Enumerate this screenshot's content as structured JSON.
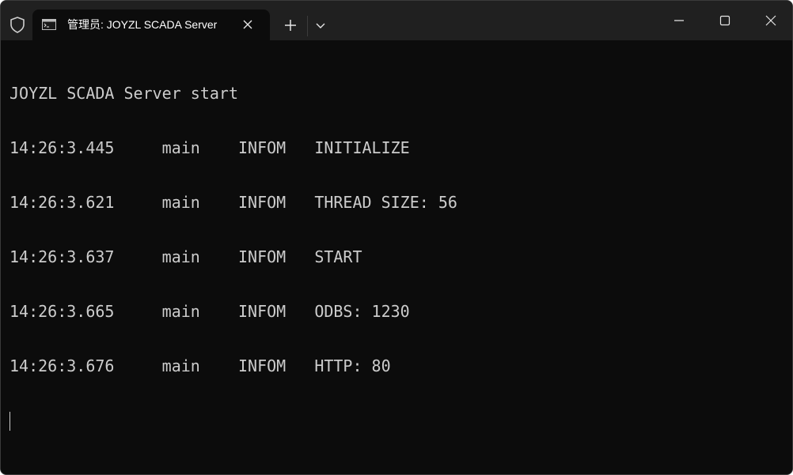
{
  "tab": {
    "title": "管理员:  JOYZL SCADA Server"
  },
  "console": {
    "lines": [
      "JOYZL SCADA Server start",
      "14:26:3.445     main    INFOM   INITIALIZE",
      "14:26:3.621     main    INFOM   THREAD SIZE: 56",
      "14:26:3.637     main    INFOM   START",
      "14:26:3.665     main    INFOM   ODBS: 1230",
      "14:26:3.676     main    INFOM   HTTP: 80"
    ]
  },
  "icons": {
    "shield": "shield-icon",
    "terminal": "terminal-icon",
    "close_tab": "close-icon",
    "new_tab": "plus-icon",
    "dropdown": "chevron-down-icon",
    "minimize": "minimize-icon",
    "maximize": "maximize-icon",
    "close_window": "close-icon"
  },
  "colors": {
    "background": "#0c0c0c",
    "titlebar": "#202020",
    "text": "#cccccc"
  }
}
